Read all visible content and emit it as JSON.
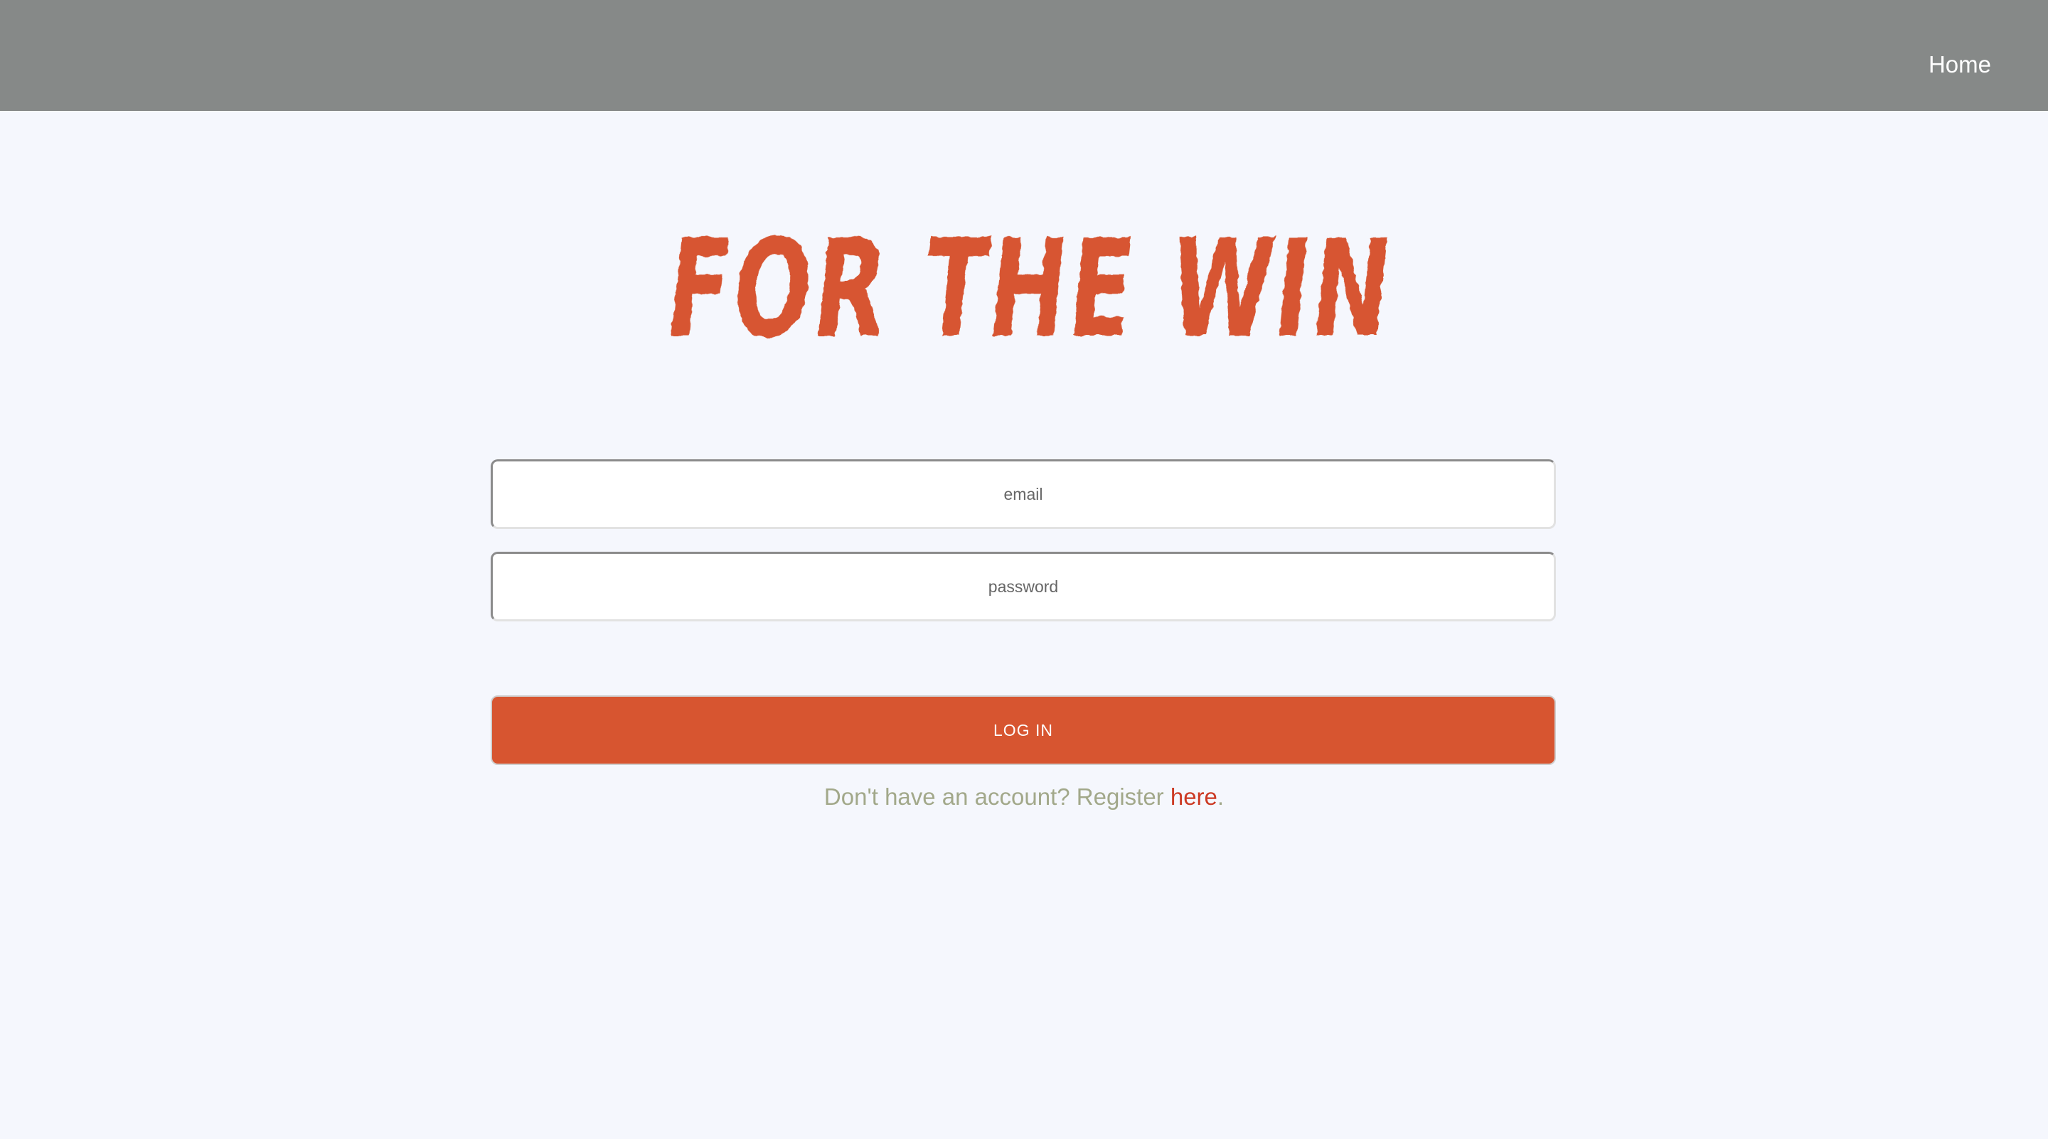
{
  "nav": {
    "home_label": "Home"
  },
  "logo": {
    "text": "FOR THE WIN"
  },
  "form": {
    "email_placeholder": "email",
    "password_placeholder": "password",
    "login_label": "LOG IN"
  },
  "register": {
    "prefix": "Don't have an account? Register ",
    "link_label": "here",
    "suffix": "."
  },
  "colors": {
    "topbar": "#868988",
    "background": "#f5f7fd",
    "accent": "#d75530",
    "muted_text": "#a2a88a",
    "link": "#cc3a24"
  }
}
